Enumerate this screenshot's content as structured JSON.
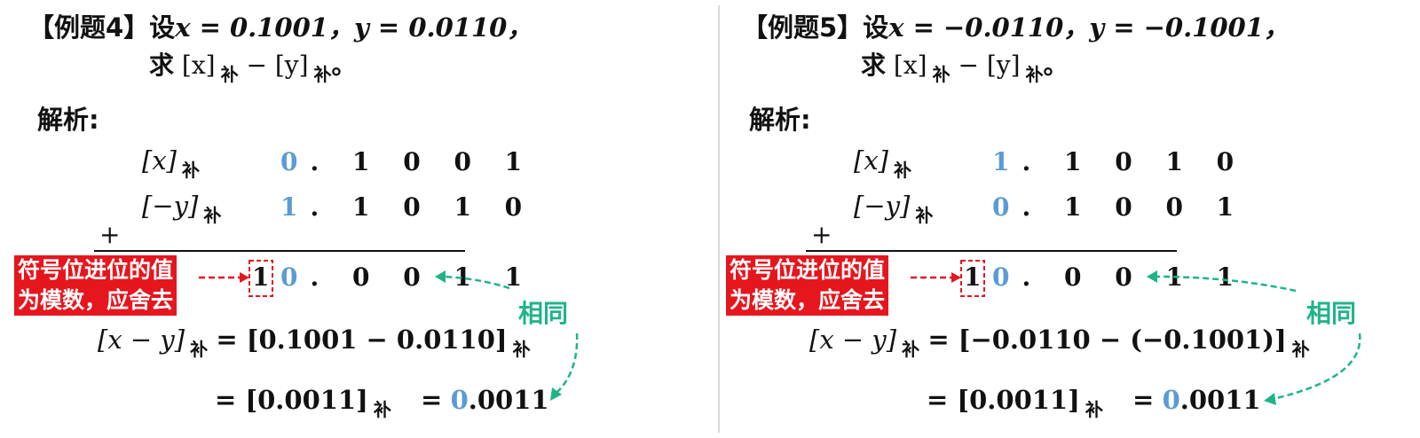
{
  "left": {
    "title": "【例题4】",
    "given_prefix": "设",
    "given_math": "x = 0.1001，y = 0.0110，",
    "ask_prefix": "求",
    "ask_math": "[x]",
    "minus": " − ",
    "ask_math2": "[y]",
    "ask_suffix": "。",
    "sub": "补",
    "analysis": "解析:",
    "row1_label": "[x]",
    "row1_sign": "0",
    "row1_rest": ". 1 0 0 1",
    "row2_label": "[−y]",
    "row2_sign": "1",
    "row2_rest": ". 1 0 1 0",
    "plus": "+",
    "note": [
      "符号位进位的值",
      "为模数，应舍去"
    ],
    "carry": "1",
    "result_sign": "0",
    "result_rest": ". 0 0 1 1",
    "same": "相同",
    "eq1_lhs": "[x − y]",
    "eq1_rhs": "= [0.1001 − 0.0110]",
    "eq2_a": "= [0.0011]",
    "eq2_b": "=",
    "eq2_sign": "0",
    "eq2_rest": ".0011"
  },
  "right": {
    "title": "【例题5】",
    "given_prefix": "设",
    "given_math": "x = −0.0110，y = −0.1001，",
    "ask_prefix": "求",
    "ask_math": "[x]",
    "minus": " − ",
    "ask_math2": "[y]",
    "ask_suffix": "。",
    "sub": "补",
    "analysis": "解析:",
    "row1_label": "[x]",
    "row1_sign": "1",
    "row1_rest": ". 1 0 1 0",
    "row2_label": "[−y]",
    "row2_sign": "0",
    "row2_rest": ". 1 0 0 1",
    "plus": "+",
    "note": [
      "符号位进位的值",
      "为模数，应舍去"
    ],
    "carry": "1",
    "result_sign": "0",
    "result_rest": ". 0 0 1 1",
    "same": "相同",
    "eq1_lhs": "[x − y]",
    "eq1_rhs": "= [−0.0110 − (−0.1001)]",
    "eq2_a": "= [0.0011]",
    "eq2_b": "=",
    "eq2_sign": "0",
    "eq2_rest": ".0011"
  },
  "colors": {
    "red": "#e5161e",
    "blue": "#5b9bd5",
    "green": "#20b38a"
  }
}
